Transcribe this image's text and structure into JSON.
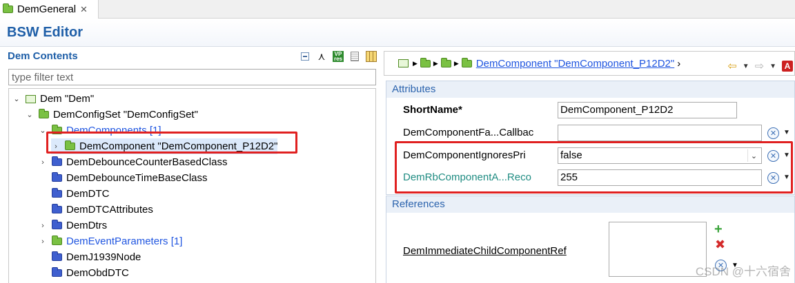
{
  "tab": {
    "label": "DemGeneral",
    "close": "✕"
  },
  "editor": {
    "title": "BSW Editor"
  },
  "left": {
    "title": "Dem Contents",
    "filter_placeholder": "type filter text",
    "tree": [
      {
        "label": "Dem \"Dem\"",
        "twisty": "⌄",
        "icon": "module",
        "level": 0
      },
      {
        "label": "DemConfigSet \"DemConfigSet\"",
        "twisty": "⌄",
        "icon": "folder-green",
        "level": 1
      },
      {
        "label": "DemComponents [1]",
        "twisty": "⌄",
        "icon": "folder-green",
        "level": 2,
        "link": true
      },
      {
        "label": "DemComponent \"DemComponent_P12D2\"",
        "twisty": "›",
        "icon": "folder-green",
        "level": 3,
        "selected": true
      },
      {
        "label": "DemDebounceCounterBasedClass",
        "twisty": "›",
        "icon": "folder-blue",
        "level": 2
      },
      {
        "label": "DemDebounceTimeBaseClass",
        "twisty": "",
        "icon": "folder-blue",
        "level": 2
      },
      {
        "label": "DemDTC",
        "twisty": "",
        "icon": "folder-blue",
        "level": 2
      },
      {
        "label": "DemDTCAttributes",
        "twisty": "",
        "icon": "folder-blue",
        "level": 2
      },
      {
        "label": "DemDtrs",
        "twisty": "›",
        "icon": "folder-blue",
        "level": 2
      },
      {
        "label": "DemEventParameters [1]",
        "twisty": "›",
        "icon": "folder-green",
        "level": 2,
        "link": true
      },
      {
        "label": "DemJ1939Node",
        "twisty": "",
        "icon": "folder-blue",
        "level": 2
      },
      {
        "label": "DemObdDTC",
        "twisty": "",
        "icon": "folder-blue",
        "level": 2
      }
    ]
  },
  "right": {
    "breadcrumb_link": "DemComponent \"DemComponent_P12D2\"",
    "breadcrumb_more": "›",
    "attributes": {
      "header": "Attributes",
      "short_name_label": "ShortName*",
      "short_name_value": "DemComponent_P12D2",
      "callback_label": "DemComponentFa...Callbac",
      "callback_value": "",
      "ignores_label": "DemComponentIgnoresPri",
      "ignores_value": "false",
      "rb_label": "DemRbComponentA...Reco",
      "rb_value": "255"
    },
    "references": {
      "header": "References",
      "label": "DemImmediateChildComponentRef"
    }
  },
  "watermark": "CSDN @十六宿舍",
  "colors": {
    "accent": "#1f5fa8",
    "link": "#1f55e0",
    "highlight": "#e02020",
    "teal": "#1f8c82"
  }
}
